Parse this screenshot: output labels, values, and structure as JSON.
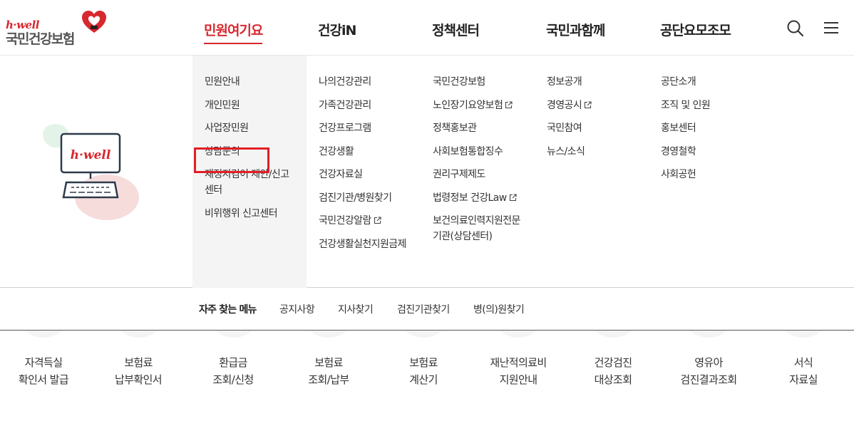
{
  "logo": {
    "brand": "h·well",
    "name": "국민건강보험"
  },
  "gnb": [
    "민원여기요",
    "건강iN",
    "정책센터",
    "국민과함께",
    "공단요모조모"
  ],
  "illustration": {
    "label": "h·well"
  },
  "menu_columns": [
    [
      "민원안내",
      "개인민원",
      "사업장민원",
      "상담문의",
      "재정지킴이 제안/신고센터",
      "비위행위 신고센터"
    ],
    [
      "나의건강관리",
      "가족건강관리",
      "건강프로그램",
      "건강생활",
      "건강자료실",
      "검진기관/병원찾기",
      "국민건강알람",
      "건강생활실천지원금제"
    ],
    [
      "국민건강보험",
      "노인장기요양보험",
      "정책홍보관",
      "사회보험통합징수",
      "권리구제제도",
      "법령정보 건강Law",
      "보건의료인력지원전문기관(상담센터)"
    ],
    [
      "정보공개",
      "경영공시",
      "국민참여",
      "뉴스/소식"
    ],
    [
      "공단소개",
      "조직 및 인원",
      "홍보센터",
      "경영철학",
      "사회공헌"
    ]
  ],
  "quick": {
    "title": "자주 찾는 메뉴",
    "links": [
      "공지사항",
      "지사찾기",
      "검진기관찾기",
      "병(의)원찾기"
    ]
  },
  "services": [
    [
      "자격득실",
      "확인서 발급"
    ],
    [
      "보험료",
      "납부확인서"
    ],
    [
      "환급금",
      "조회/신청"
    ],
    [
      "보험료",
      "조회/납부"
    ],
    [
      "보험료",
      "계산기"
    ],
    [
      "재난적의료비",
      "지원안내"
    ],
    [
      "건강검진",
      "대상조회"
    ],
    [
      "영유아",
      "검진결과조회"
    ],
    [
      "서식",
      "자료실"
    ]
  ],
  "colors": {
    "accent": "#d7282f",
    "highlight": "#e21f26",
    "menu_bg": "#f4f4f4"
  }
}
